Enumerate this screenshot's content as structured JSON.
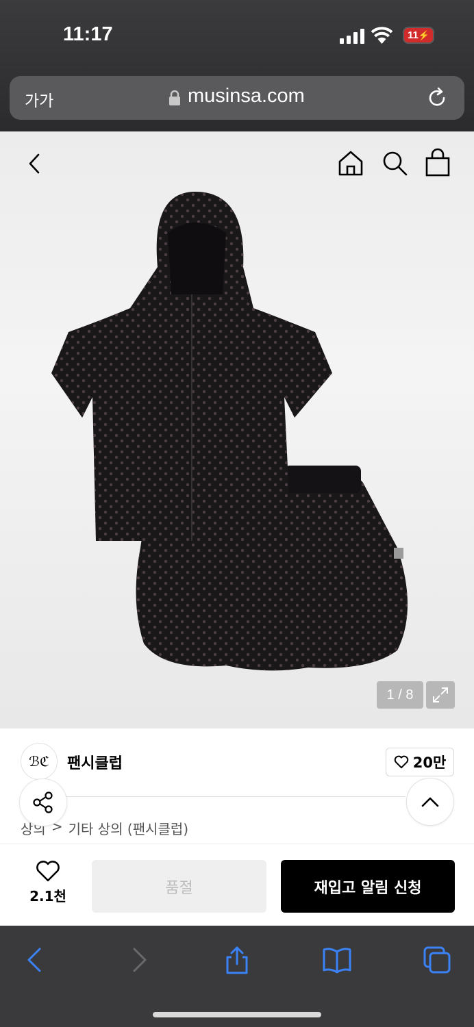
{
  "status": {
    "time": "11:17",
    "battery": "11"
  },
  "browser": {
    "text_size": "가가",
    "url": "musinsa.com"
  },
  "gallery": {
    "counter": "1 / 8"
  },
  "brand": {
    "logo_text": "ℬℭ",
    "name": "팬시클럽",
    "likes": "20만"
  },
  "breadcrumb": {
    "category": "상의",
    "separator": ">",
    "subcategory": "기타 상의 (팬시클럽)"
  },
  "buybar": {
    "wish_count": "2.1천",
    "soldout_label": "품절",
    "restock_label": "재입고 알림 신청"
  },
  "colors": {
    "accent": "#000000",
    "safari_blue": "#3b82f6",
    "chrome": "#3a3a3c"
  }
}
